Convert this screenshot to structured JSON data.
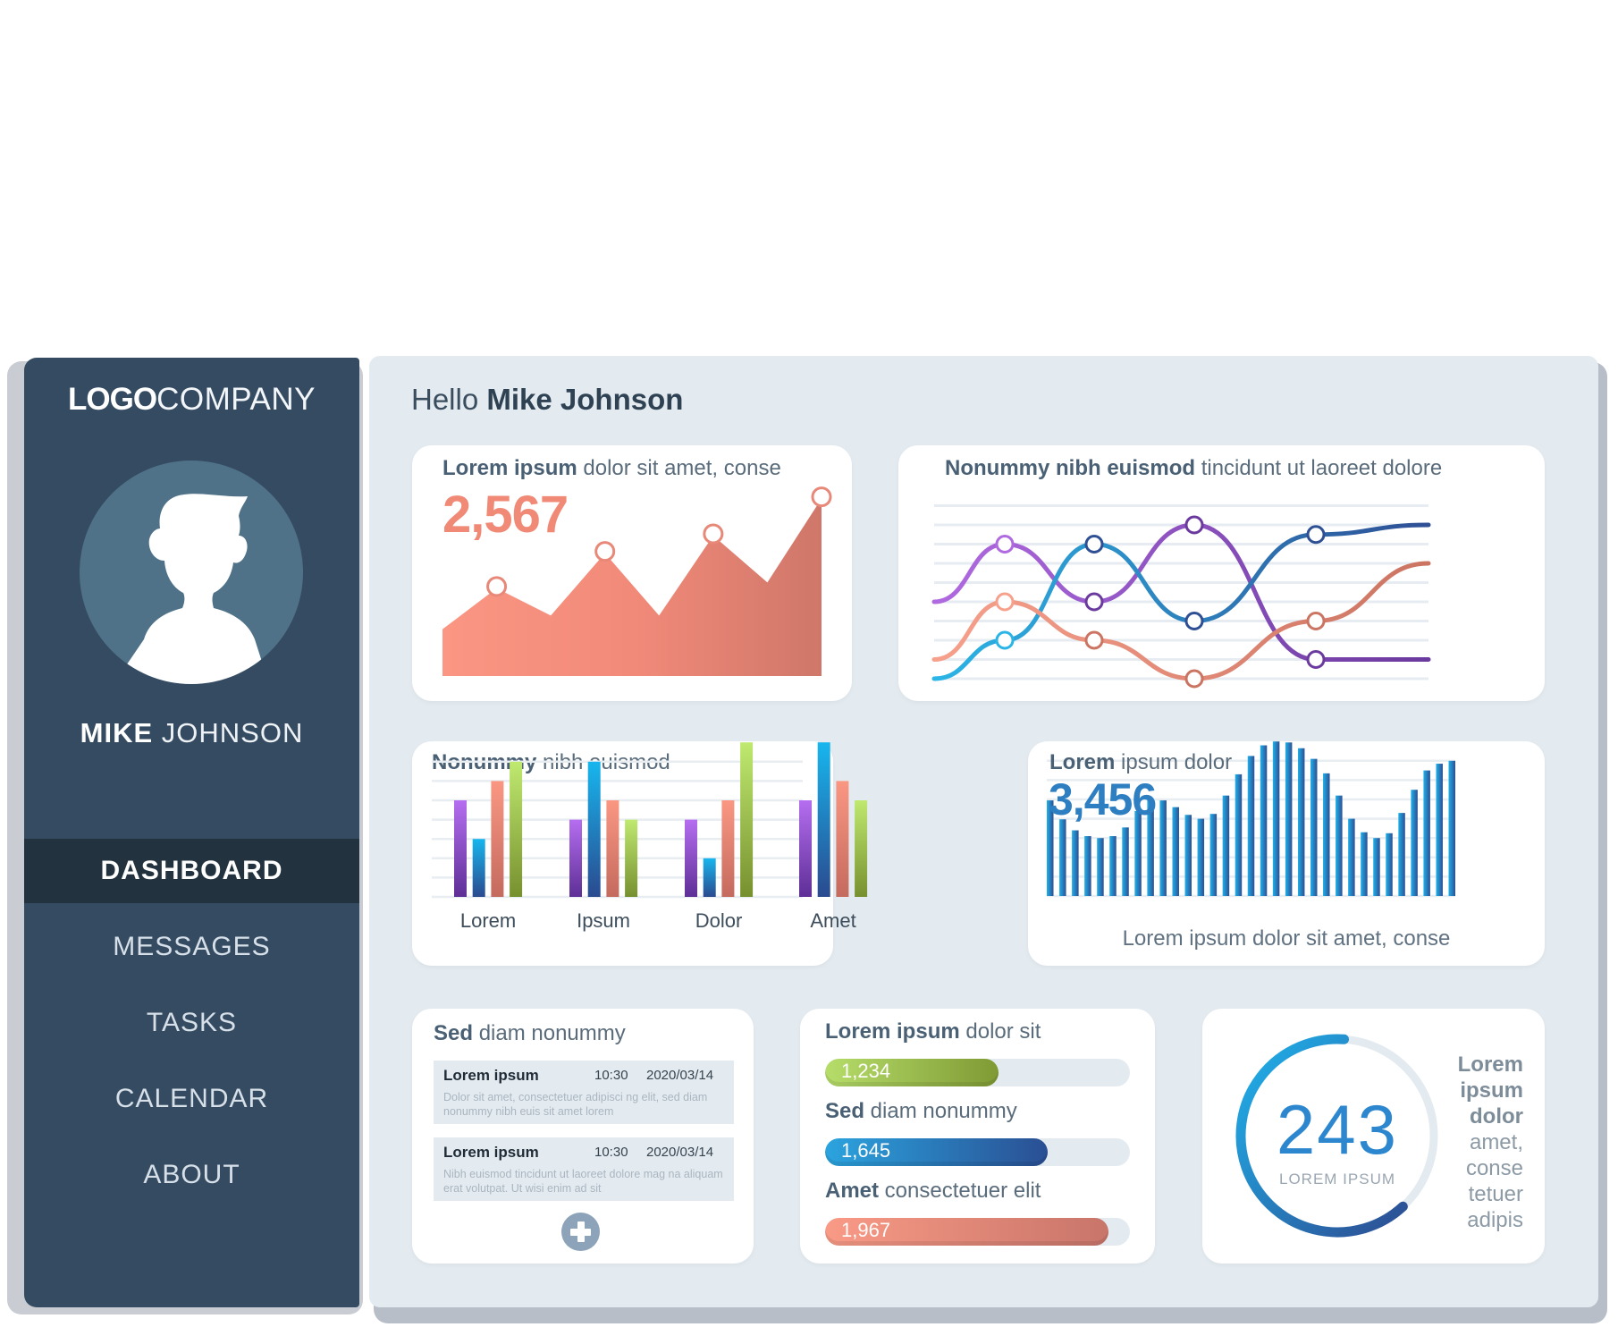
{
  "sidebar": {
    "logo_bold": "LOGO",
    "logo_light": "COMPANY",
    "user_first": "MIKE",
    "user_last": "JOHNSON",
    "avatar_icon": "user-silhouette-icon",
    "nav": [
      {
        "label": "DASHBOARD",
        "active": true
      },
      {
        "label": "MESSAGES",
        "active": false
      },
      {
        "label": "TASKS",
        "active": false
      },
      {
        "label": "CALENDAR",
        "active": false
      },
      {
        "label": "ABOUT",
        "active": false
      }
    ]
  },
  "header": {
    "greeting": "Hello",
    "name": "Mike Johnson"
  },
  "colors": {
    "sidebar_bg": "#344b62",
    "sidebar_active": "#22323f",
    "panel_bg": "#e4ebf0",
    "salmon": "#f08a77",
    "purple": "#9c5bd6",
    "blue": "#2a8fd3",
    "green": "#9fc84e",
    "navy": "#2f5c9e"
  },
  "cards": {
    "area": {
      "title_bold": "Lorem ipsum",
      "title_rest": "dolor sit amet, conse",
      "value": "2,567"
    },
    "lines": {
      "title_bold": "Nonummy nibh euismod",
      "title_rest": "tincidunt ut laoreet dolore"
    },
    "bars": {
      "title_bold": "Nonummy",
      "title_rest": "nibh euismod"
    },
    "stripes": {
      "title_bold": "Lorem",
      "title_rest": "ipsum dolor",
      "value": "3,456",
      "caption": "Lorem ipsum dolor sit amet, conse"
    },
    "messages": {
      "title_bold": "Sed",
      "title_rest": "diam nonummy",
      "items": [
        {
          "title": "Lorem ipsum",
          "time": "10:30",
          "date": "2020/03/14",
          "body": "Dolor sit amet, consectetuer adipisci ng elit, sed diam nonummy nibh euis sit amet lorem"
        },
        {
          "title": "Lorem ipsum",
          "time": "10:30",
          "date": "2020/03/14",
          "body": "Nibh euismod tincidunt ut laoreet dolore mag na aliquam erat volutpat. Ut wisi enim ad sit"
        }
      ],
      "add_icon": "plus-circle-icon"
    },
    "progress": {
      "items": [
        {
          "label_bold": "Lorem ipsum",
          "label_rest": "dolor sit",
          "value": "1,234",
          "fraction": 0.57,
          "color_from": "#b6dd6a",
          "color_to": "#7f9a34"
        },
        {
          "label_bold": "Sed",
          "label_rest": "diam nonummy",
          "value": "1,645",
          "fraction": 0.73,
          "color_from": "#2ba4df",
          "color_to": "#2a4f93"
        },
        {
          "label_bold": "Amet",
          "label_rest": "consectetuer elit",
          "value": "1,967",
          "fraction": 0.93,
          "color_from": "#f99a86",
          "color_to": "#c8756a"
        }
      ]
    },
    "gauge": {
      "value": "243",
      "label": "LOREM IPSUM",
      "fraction": 0.63,
      "text_bold": [
        "Lorem",
        "ipsum",
        "dolor"
      ],
      "text_rest": [
        "amet,",
        "conse",
        "tetuer",
        "adipis"
      ]
    }
  },
  "chart_data": [
    {
      "type": "area",
      "title": "Lorem ipsum dolor sit amet, conse",
      "headline_value": "2,567",
      "values": [
        24,
        45,
        31,
        63,
        31,
        72,
        48,
        91
      ],
      "markers_at": [
        1,
        3,
        5,
        7
      ],
      "ylim": [
        0,
        100
      ],
      "grid": false
    },
    {
      "type": "line",
      "title": "Nonummy nibh euismod tincidunt ut laoreet dolore",
      "x": [
        0,
        1,
        2,
        3,
        4,
        5
      ],
      "ylim": [
        0,
        9
      ],
      "grid": true,
      "series": [
        {
          "name": "purple",
          "values": [
            4,
            7,
            4,
            8,
            1,
            1
          ],
          "color_from": "#b06ae0",
          "color_to": "#6a3a9e"
        },
        {
          "name": "blue",
          "values": [
            0,
            2,
            7,
            3,
            7.5,
            8
          ],
          "color_from": "#2bb5e6",
          "color_to": "#2f4f95"
        },
        {
          "name": "salmon",
          "values": [
            1,
            4,
            2,
            0,
            3,
            6
          ],
          "color_from": "#f7a08c",
          "color_to": "#cc7462"
        }
      ],
      "markers_at": [
        1,
        2,
        3,
        4
      ]
    },
    {
      "type": "bar",
      "title": "Nonummy nibh euismod",
      "categories": [
        "Lorem",
        "Ipsum",
        "Dolor",
        "Amet"
      ],
      "ylim": [
        0,
        8
      ],
      "grid": true,
      "series": [
        {
          "name": "purple",
          "values": [
            5,
            4,
            4,
            5
          ],
          "color_from": "#b56ef0",
          "color_to": "#5e2f96"
        },
        {
          "name": "blue",
          "values": [
            3,
            7,
            2,
            8
          ],
          "color_from": "#17b6ee",
          "color_to": "#2a4a8f"
        },
        {
          "name": "salmon",
          "values": [
            6,
            5,
            5,
            6
          ],
          "color_from": "#fa9783",
          "color_to": "#c46a5e"
        },
        {
          "name": "green",
          "values": [
            7,
            4,
            8,
            5
          ],
          "color_from": "#bfe96f",
          "color_to": "#77902f"
        }
      ]
    },
    {
      "type": "bar",
      "title": "Lorem ipsum dolor",
      "headline_value": "3,456",
      "xlabel": "Lorem ipsum dolor sit amet, conse",
      "ylim": [
        0,
        8
      ],
      "grid": true,
      "values": [
        4.95,
        3.97,
        3.4,
        3.1,
        3.0,
        3.1,
        3.55,
        4.4,
        4.95,
        4.95,
        4.6,
        4.2,
        4.0,
        4.25,
        5.2,
        6.3,
        7.25,
        7.8,
        8.0,
        7.95,
        7.65,
        7.1,
        6.35,
        5.2,
        4.0,
        3.3,
        3.0,
        3.25,
        4.3,
        5.5,
        6.5,
        6.85,
        7.0
      ],
      "color_from": "#1fb0ea",
      "color_to": "#2c4f93"
    }
  ]
}
